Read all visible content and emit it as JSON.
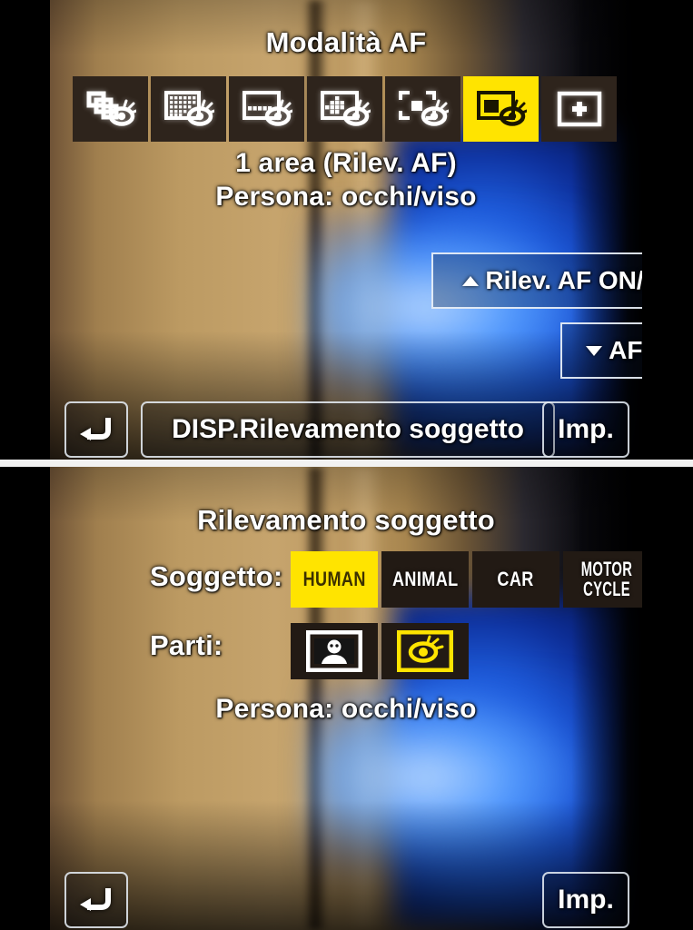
{
  "top_screen": {
    "title": "Modalità AF",
    "af_modes": [
      {
        "id": "tracking",
        "icon": "af-tracking-eye-icon",
        "selected": false
      },
      {
        "id": "225-area",
        "icon": "af-225area-eye-icon",
        "selected": false
      },
      {
        "id": "zone-horizontal-vertical",
        "icon": "af-zone-hv-eye-icon",
        "selected": false
      },
      {
        "id": "zone-cross",
        "icon": "af-zone-cross-eye-icon",
        "selected": false
      },
      {
        "id": "1-area-plus",
        "icon": "af-1area-plus-eye-icon",
        "selected": false
      },
      {
        "id": "1-area",
        "icon": "af-1area-eye-icon",
        "selected": true
      },
      {
        "id": "pinpoint",
        "icon": "af-pinpoint-icon",
        "selected": false
      }
    ],
    "mode_name": "1 area (Rilev. AF)",
    "detection_summary": "Persona: occhi/viso",
    "buttons": {
      "detect_toggle": "Rilev. AF ON/OFF",
      "af_area": "AF area",
      "disp": "DISP.Rilevamento soggetto",
      "confirm": "Imp.",
      "back_icon": "back-arrow-icon",
      "up_icon": "triangle-up-icon",
      "down_icon": "triangle-down-icon"
    }
  },
  "bottom_screen": {
    "title": "Rilevamento soggetto",
    "subject_label": "Soggetto:",
    "subjects": [
      {
        "label": "HUMAN",
        "selected": true
      },
      {
        "label": "ANIMAL",
        "selected": false
      },
      {
        "label": "CAR",
        "selected": false
      },
      {
        "label": "MOTOR\nCYCLE",
        "line1": "MOTOR",
        "line2": "CYCLE",
        "selected": false
      }
    ],
    "parts_label": "Parti:",
    "parts": [
      {
        "id": "face-body",
        "icon": "person-face-body-icon",
        "selected": false
      },
      {
        "id": "eye-face",
        "icon": "eye-detection-icon",
        "selected": true
      }
    ],
    "detection_summary": "Persona: occhi/viso",
    "buttons": {
      "confirm": "Imp.",
      "back_icon": "back-arrow-icon"
    }
  },
  "colors": {
    "highlight_yellow": "#ffe400",
    "cell_background": "#221a14",
    "osd_text": "#ffffff"
  }
}
